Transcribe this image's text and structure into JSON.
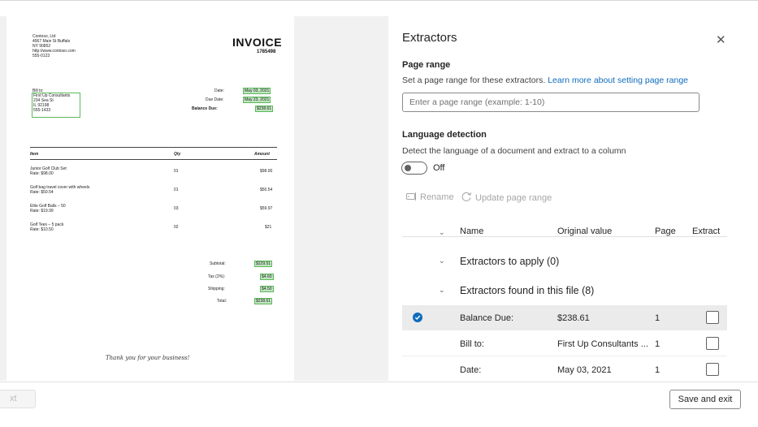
{
  "document": {
    "company_lines": [
      "Contoso, Ltd",
      "4567 Main St Buffalo",
      "NY 90852",
      "http://www.contoso.com",
      "555-0123"
    ],
    "invoice_title": "INVOICE",
    "invoice_number": "1785498",
    "bill_to_label": "Bill to:",
    "bill_to_lines": [
      "First Up Consultants",
      "234 Sea St",
      "IL 92198",
      "555-1433"
    ],
    "date_label": "Date:",
    "date_value": "May 03, 2021",
    "due_label": "Due Date:",
    "due_value": "May 23, 2021",
    "balance_label": "Balance Due:",
    "balance_value": "$238.61",
    "col_item": "Item",
    "col_qty": "Qty",
    "col_amount": "Amount",
    "items": [
      {
        "name": "Junior Golf Club Set",
        "rate": "Rate: $98.00",
        "qty": "01",
        "amount": "$98.00"
      },
      {
        "name": "Golf bag travel cover with wheels",
        "rate": "Rate: $50.54",
        "qty": "01",
        "amount": "$50.54"
      },
      {
        "name": "Elite Golf Balls – 50",
        "rate": "Rate: $19.99",
        "qty": "03",
        "amount": "$59.97"
      },
      {
        "name": "Golf Tees – 5 pack",
        "rate": "Rate: $10.50",
        "qty": "02",
        "amount": "$21"
      }
    ],
    "subtotal_label": "Subtotal:",
    "subtotal_value": "$229.51",
    "tax_label": "Tax (2%):",
    "tax_value": "$4.60",
    "shipping_label": "Shipping:",
    "shipping_value": "$4.50",
    "total_label": "Total:",
    "total_value": "$238.61",
    "thanks": "Thank you for your business!"
  },
  "panel": {
    "title": "Extractors",
    "page_range_label": "Page range",
    "page_range_desc": "Set a page range for these extractors.",
    "page_range_link": "Learn more about setting page range",
    "page_range_placeholder": "Enter a page range (example: 1-10)",
    "lang_label": "Language detection",
    "lang_desc": "Detect the language of a document and extract to a column",
    "toggle_state": "Off",
    "rename_label": "Rename",
    "update_label": "Update page range",
    "columns": {
      "name": "Name",
      "original": "Original value",
      "page": "Page",
      "extract": "Extract"
    },
    "group_apply": "Extractors to apply (0)",
    "group_found": "Extractors found in this file (8)",
    "rows": [
      {
        "name": "Balance Due:",
        "value": "$238.61",
        "page": "1"
      },
      {
        "name": "Bill to:",
        "value": "First Up Consultants ...",
        "page": "1"
      },
      {
        "name": "Date:",
        "value": "May 03, 2021",
        "page": "1"
      }
    ]
  },
  "footer": {
    "back_label": "xt",
    "save_label": "Save and exit"
  },
  "colors": {
    "accent": "#0f6cbd",
    "highlight": "#bfe6bf",
    "highlight_border": "#5cb85c"
  }
}
